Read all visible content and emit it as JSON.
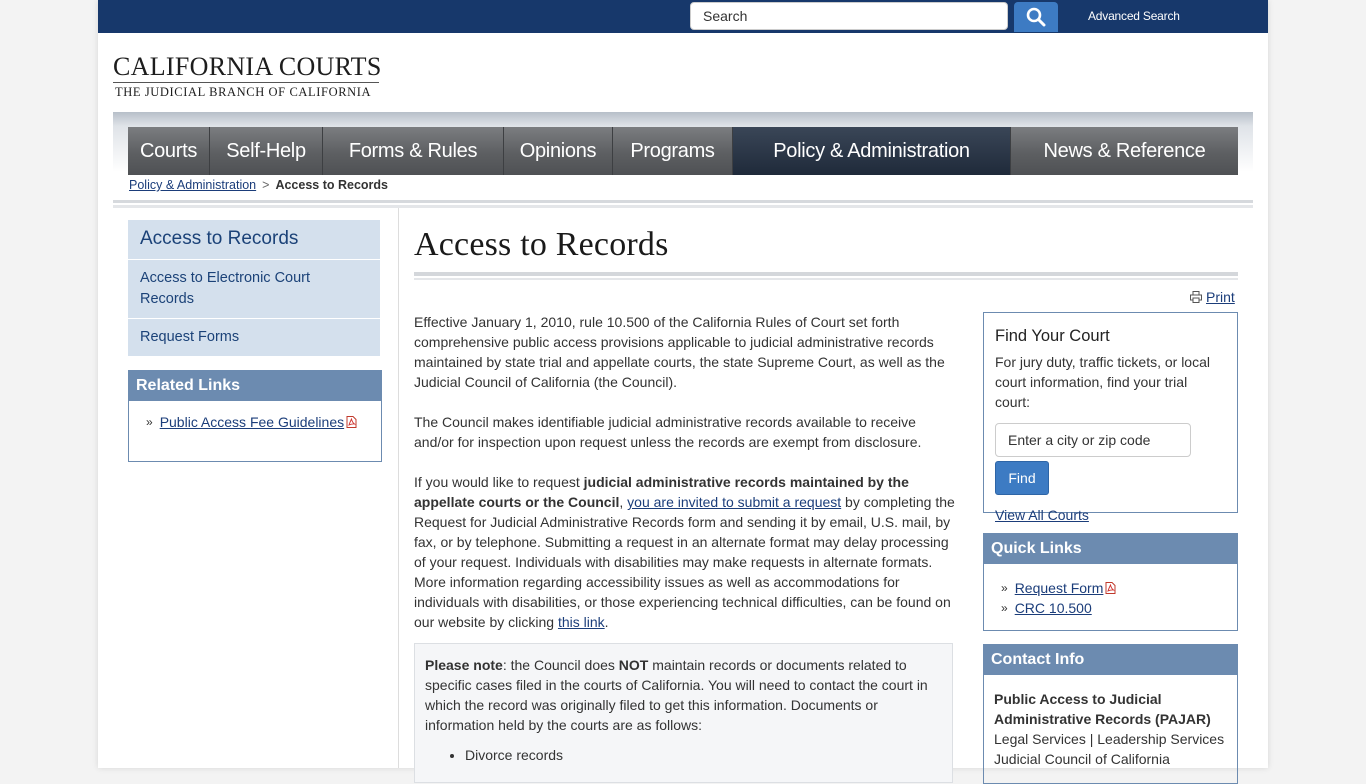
{
  "header": {
    "search_placeholder": "Search",
    "advanced_search": "Advanced Search"
  },
  "logo": {
    "title": "CALIFORNIA COURTS",
    "subtitle": "THE JUDICIAL BRANCH OF CALIFORNIA"
  },
  "nav": {
    "items": [
      "Courts",
      "Self-Help",
      "Forms & Rules",
      "Opinions",
      "Programs",
      "Policy & Administration",
      "News & Reference"
    ],
    "active": "Policy & Administration"
  },
  "breadcrumb": {
    "parent": "Policy & Administration",
    "separator": ">",
    "current": "Access to Records"
  },
  "sidebar": {
    "title": "Access to Records",
    "items": [
      "Access to Electronic Court Records",
      "Request Forms"
    ],
    "related_title": "Related Links",
    "related_links": [
      "Public Access Fee Guidelines"
    ]
  },
  "main": {
    "title": "Access to Records",
    "print": "Print",
    "p1": "Effective January 1, 2010, rule 10.500 of the California Rules of Court set forth comprehensive public access provisions applicable to judicial administrative records maintained by state trial and appellate courts, the state Supreme Court, as well as the Judicial Council of California (the Council).",
    "p2": "The Council makes identifiable judicial administrative records available to receive and/or for inspection upon request unless the records are exempt from disclosure.",
    "p3_a": "If you would like to request ",
    "p3_bold": "judicial administrative records maintained by the appellate courts or the Council",
    "p3_b": ", ",
    "p3_link": "you are invited to submit a request",
    "p3_c": " by completing the Request for Judicial Administrative Records form and sending it by email, U.S. mail, by fax, or by telephone. Submitting a request in an alternate format may delay processing of your request. Individuals with disabilities may make requests in alternate formats. More information regarding accessibility issues as well as accommodations for individuals with disabilities, or those experiencing technical difficulties, can be found on our website by clicking ",
    "p3_link2": "this link",
    "p3_end": ".",
    "note_label": "Please note",
    "note_a": ": the Council does ",
    "note_not": "NOT",
    "note_b": " maintain records or documents related to specific cases filed in the courts of California. You will need to contact the court in which the record was originally filed to get this information. Documents or information held by the courts are as follows:",
    "note_items": [
      "Divorce records"
    ]
  },
  "find_court": {
    "title": "Find Your Court",
    "text": "For jury duty, traffic tickets, or local court information, find your trial court:",
    "placeholder": "Enter a city or zip code",
    "button": "Find",
    "view_all": "View All Courts"
  },
  "quick_links": {
    "title": "Quick Links",
    "items": [
      "Request Form",
      "CRC 10.500"
    ]
  },
  "contact": {
    "title": "Contact Info",
    "org": "Public Access to Judicial Administrative Records (PAJAR)",
    "line1": "Legal Services | Leadership Services",
    "line2": "Judicial Council of California"
  },
  "colors": {
    "topbar": "#17386b",
    "accent_blue": "#3d7bc3",
    "box_header": "#6c8bb0",
    "subnav_bg": "#d4e0ed"
  }
}
